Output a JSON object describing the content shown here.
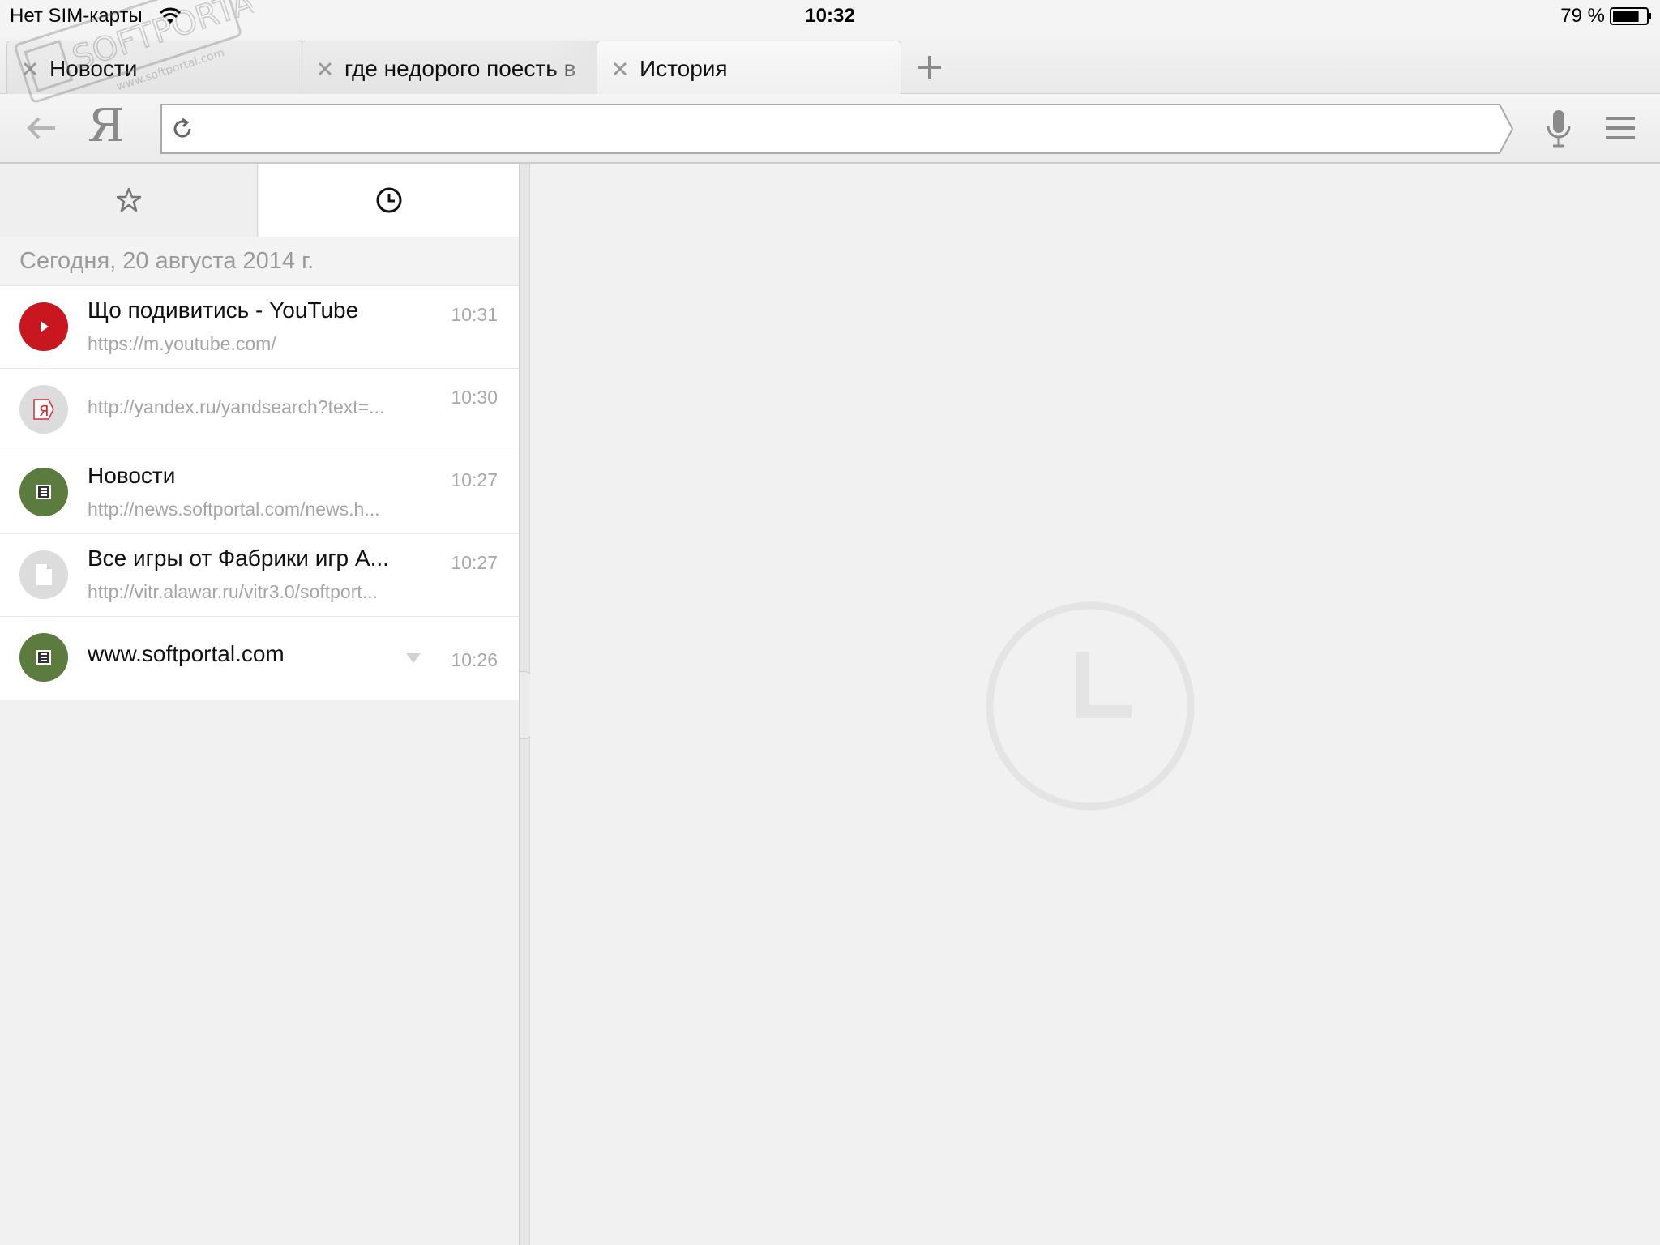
{
  "status_bar": {
    "carrier": "Нет SIM-карты",
    "time": "10:32",
    "battery_text": "79 %",
    "battery_level": 0.79
  },
  "tabs": [
    {
      "title": "Новости",
      "active": false
    },
    {
      "title": "где недорого поесть в",
      "active": false
    },
    {
      "title": "История",
      "active": true
    }
  ],
  "toolbar": {
    "logo": "Я",
    "omnibox_value": ""
  },
  "panel": {
    "date_header": "Сегодня, 20 августа 2014 г.",
    "items": [
      {
        "title": "Що подивитись - YouTube",
        "url": "https://m.youtube.com/",
        "time": "10:31",
        "icon": "youtube-icon"
      },
      {
        "title": "",
        "url": "http://yandex.ru/yandsearch?text=...",
        "time": "10:30",
        "icon": "yandex-icon"
      },
      {
        "title": "Новости",
        "url": "http://news.softportal.com/news.h...",
        "time": "10:27",
        "icon": "softportal-icon"
      },
      {
        "title": "Все игры от Фабрики игр А...",
        "url": "http://vitr.alawar.ru/vitr3.0/softport...",
        "time": "10:27",
        "icon": "page-icon"
      },
      {
        "title": "www.softportal.com",
        "url": "",
        "time": "10:26",
        "icon": "softportal-icon"
      }
    ]
  },
  "watermark": {
    "text": "SOFTPORTAL",
    "sub": "www.softportal.com"
  },
  "colors": {
    "youtube": "#c8171e",
    "softportal": "#5b7b3f",
    "neutral_icon": "#dcdcdc",
    "accent_text": "#111111",
    "muted_text": "#a5a5a5"
  }
}
